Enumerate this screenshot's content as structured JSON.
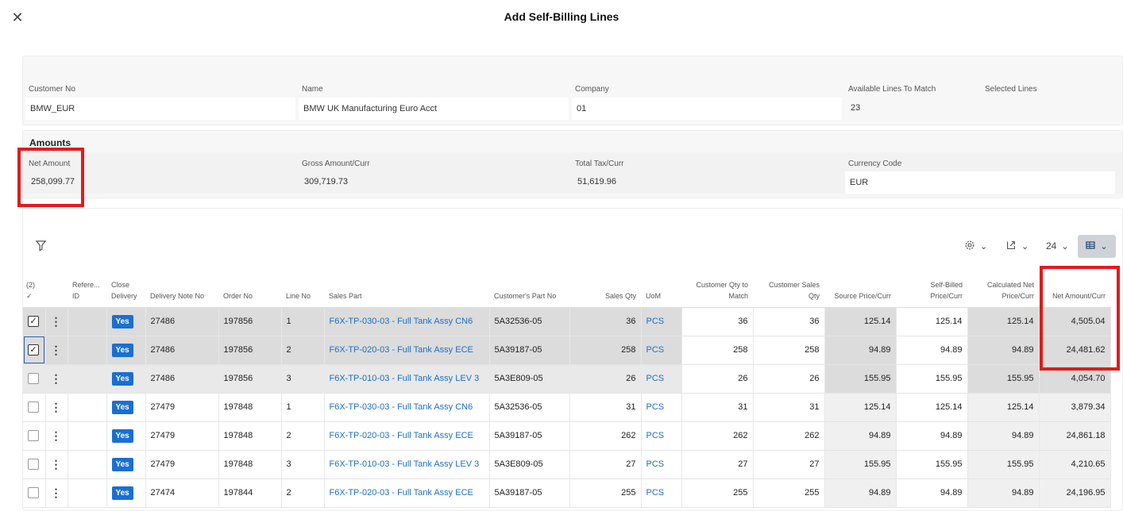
{
  "dialog": {
    "title": "Add Self-Billing Lines",
    "close_glyph": "✕"
  },
  "header_fields": {
    "customer_no": {
      "label": "Customer No",
      "value": "BMW_EUR"
    },
    "name": {
      "label": "Name",
      "value": "BMW  UK Manufacturing Euro Acct"
    },
    "company": {
      "label": "Company",
      "value": "01"
    },
    "available_lines": {
      "label": "Available Lines To Match",
      "value": "23"
    },
    "selected_lines": {
      "label": "Selected Lines",
      "value": ""
    }
  },
  "amounts": {
    "section_title": "Amounts",
    "net_amount": {
      "label": "Net Amount",
      "value": "258,099.77"
    },
    "gross_amount": {
      "label": "Gross Amount/Curr",
      "value": "309,719.73"
    },
    "total_tax": {
      "label": "Total Tax/Curr",
      "value": "51,619.96"
    },
    "currency_code": {
      "label": "Currency Code",
      "value": "EUR"
    }
  },
  "toolbar": {
    "filter_icon": "filter-icon",
    "settings_icon": "gear-icon",
    "export_icon": "export-icon",
    "page_size": "24",
    "view_icon": "table-view-icon",
    "chevron": "⌄"
  },
  "columns": {
    "select": "(2)",
    "select_check": "✓",
    "reference_id": "Refere... ID",
    "close_delivery": "Close Delivery",
    "delivery_note_no": "Delivery Note No",
    "order_no": "Order No",
    "line_no": "Line No",
    "sales_part": "Sales Part",
    "customers_part_no": "Customer's Part No",
    "sales_qty": "Sales Qty",
    "uom": "UoM",
    "customer_qty_to_match": "Customer Qty to Match",
    "customer_sales_qty": "Customer Sales Qty",
    "source_price": "Source Price/Curr",
    "self_billed_price": "Self-Billed Price/Curr",
    "calculated_net_price": "Calculated Net Price/Curr",
    "net_amount": "Net Amount/Curr"
  },
  "rows": [
    {
      "checked": true,
      "close_delivery": "Yes",
      "delivery_note_no": "27486",
      "order_no": "197856",
      "line_no": "1",
      "sales_part": "F6X-TP-030-03 - Full Tank Assy CN6",
      "customers_part_no": "5A32536-05",
      "sales_qty": "36",
      "uom": "PCS",
      "customer_qty_to_match": "36",
      "customer_sales_qty": "36",
      "source_price": "125.14",
      "self_billed_price": "125.14",
      "calculated_net_price": "125.14",
      "net_amount": "4,505.04"
    },
    {
      "checked": true,
      "close_delivery": "Yes",
      "delivery_note_no": "27486",
      "order_no": "197856",
      "line_no": "2",
      "sales_part": "F6X-TP-020-03 - Full Tank Assy ECE",
      "customers_part_no": "5A39187-05",
      "sales_qty": "258",
      "uom": "PCS",
      "customer_qty_to_match": "258",
      "customer_sales_qty": "258",
      "source_price": "94.89",
      "self_billed_price": "94.89",
      "calculated_net_price": "94.89",
      "net_amount": "24,481.62"
    },
    {
      "checked": false,
      "close_delivery": "Yes",
      "delivery_note_no": "27486",
      "order_no": "197856",
      "line_no": "3",
      "sales_part": "F6X-TP-010-03 - Full Tank Assy LEV 3",
      "customers_part_no": "5A3E809-05",
      "sales_qty": "26",
      "uom": "PCS",
      "customer_qty_to_match": "26",
      "customer_sales_qty": "26",
      "source_price": "155.95",
      "self_billed_price": "155.95",
      "calculated_net_price": "155.95",
      "net_amount": "4,054.70"
    },
    {
      "checked": false,
      "close_delivery": "Yes",
      "delivery_note_no": "27479",
      "order_no": "197848",
      "line_no": "1",
      "sales_part": "F6X-TP-030-03 - Full Tank Assy CN6",
      "customers_part_no": "5A32536-05",
      "sales_qty": "31",
      "uom": "PCS",
      "customer_qty_to_match": "31",
      "customer_sales_qty": "31",
      "source_price": "125.14",
      "self_billed_price": "125.14",
      "calculated_net_price": "125.14",
      "net_amount": "3,879.34"
    },
    {
      "checked": false,
      "close_delivery": "Yes",
      "delivery_note_no": "27479",
      "order_no": "197848",
      "line_no": "2",
      "sales_part": "F6X-TP-020-03 - Full Tank Assy ECE",
      "customers_part_no": "5A39187-05",
      "sales_qty": "262",
      "uom": "PCS",
      "customer_qty_to_match": "262",
      "customer_sales_qty": "262",
      "source_price": "94.89",
      "self_billed_price": "94.89",
      "calculated_net_price": "94.89",
      "net_amount": "24,861.18"
    },
    {
      "checked": false,
      "close_delivery": "Yes",
      "delivery_note_no": "27479",
      "order_no": "197848",
      "line_no": "3",
      "sales_part": "F6X-TP-010-03 - Full Tank Assy LEV 3",
      "customers_part_no": "5A3E809-05",
      "sales_qty": "27",
      "uom": "PCS",
      "customer_qty_to_match": "27",
      "customer_sales_qty": "27",
      "source_price": "155.95",
      "self_billed_price": "155.95",
      "calculated_net_price": "155.95",
      "net_amount": "4,210.65"
    },
    {
      "checked": false,
      "close_delivery": "Yes",
      "delivery_note_no": "27474",
      "order_no": "197844",
      "line_no": "2",
      "sales_part": "F6X-TP-020-03 - Full Tank Assy ECE",
      "customers_part_no": "5A39187-05",
      "sales_qty": "255",
      "uom": "PCS",
      "customer_qty_to_match": "255",
      "customer_sales_qty": "255",
      "source_price": "94.89",
      "self_billed_price": "94.89",
      "calculated_net_price": "94.89",
      "net_amount": "24,196.95"
    }
  ],
  "colors": {
    "highlight": "#e01b1b",
    "link": "#1e6fc2",
    "yes_badge": "#1a6fd3"
  }
}
